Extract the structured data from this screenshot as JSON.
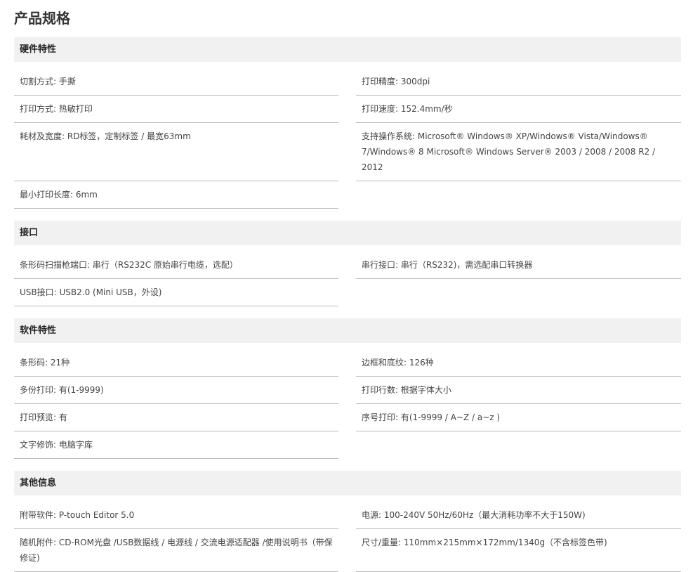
{
  "title": "产品规格",
  "sections": [
    {
      "heading": "硬件特性",
      "rows": [
        [
          "切割方式: 手撕",
          "打印精度: 300dpi"
        ],
        [
          "打印方式: 热敏打印",
          "打印速度: 152.4mm/秒"
        ],
        [
          "耗材及宽度: RD标签，定制标签 / 最宽63mm",
          "支持操作系统: Microsoft® Windows® XP/Windows® Vista/Windows® 7/Windows® 8 Microsoft® Windows Server® 2003 / 2008 / 2008 R2 / 2012"
        ],
        [
          "最小打印长度: 6mm",
          ""
        ]
      ]
    },
    {
      "heading": "接口",
      "rows": [
        [
          "条形码扫描枪端口: 串行（RS232C 原始串行电缆，选配）",
          "串行接口: 串行（RS232)，需选配串口转换器"
        ],
        [
          "USB接口: USB2.0 (Mini USB，外设)",
          ""
        ]
      ]
    },
    {
      "heading": "软件特性",
      "rows": [
        [
          "条形码: 21种",
          "边框和底纹: 126种"
        ],
        [
          "多份打印: 有(1-9999)",
          "打印行数: 根据字体大小"
        ],
        [
          "打印预览: 有",
          "序号打印: 有(1-9999 / A~Z / a~z )"
        ],
        [
          "文字修饰: 电脑字库",
          ""
        ]
      ]
    },
    {
      "heading": "其他信息",
      "rows": [
        [
          "附带软件: P-touch Editor 5.0",
          "电源: 100-240V 50Hz/60Hz（最大消耗功率不大于150W)"
        ],
        [
          "随机附件: CD-ROM光盘 /USB数据线 / 电源线 / 交流电源适配器 /使用说明书（带保修证)",
          "尺寸/重量: 110mm×215mm×172mm/1340g（不含标签色带)"
        ]
      ]
    }
  ]
}
